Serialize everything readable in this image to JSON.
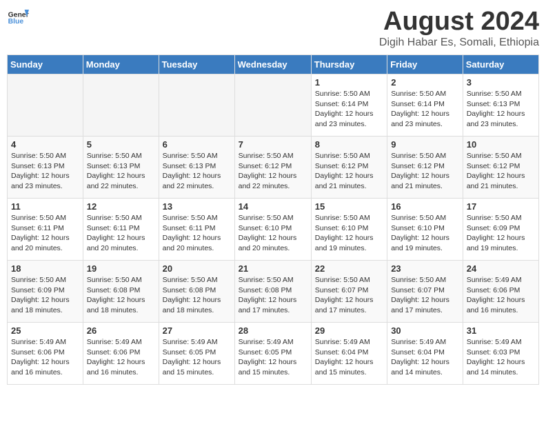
{
  "logo": {
    "text_general": "General",
    "text_blue": "Blue"
  },
  "title": "August 2024",
  "location": "Digih Habar Es, Somali, Ethiopia",
  "weekdays": [
    "Sunday",
    "Monday",
    "Tuesday",
    "Wednesday",
    "Thursday",
    "Friday",
    "Saturday"
  ],
  "weeks": [
    [
      {
        "day": "",
        "info": ""
      },
      {
        "day": "",
        "info": ""
      },
      {
        "day": "",
        "info": ""
      },
      {
        "day": "",
        "info": ""
      },
      {
        "day": "1",
        "info": "Sunrise: 5:50 AM\nSunset: 6:14 PM\nDaylight: 12 hours\nand 23 minutes."
      },
      {
        "day": "2",
        "info": "Sunrise: 5:50 AM\nSunset: 6:14 PM\nDaylight: 12 hours\nand 23 minutes."
      },
      {
        "day": "3",
        "info": "Sunrise: 5:50 AM\nSunset: 6:13 PM\nDaylight: 12 hours\nand 23 minutes."
      }
    ],
    [
      {
        "day": "4",
        "info": "Sunrise: 5:50 AM\nSunset: 6:13 PM\nDaylight: 12 hours\nand 23 minutes."
      },
      {
        "day": "5",
        "info": "Sunrise: 5:50 AM\nSunset: 6:13 PM\nDaylight: 12 hours\nand 22 minutes."
      },
      {
        "day": "6",
        "info": "Sunrise: 5:50 AM\nSunset: 6:13 PM\nDaylight: 12 hours\nand 22 minutes."
      },
      {
        "day": "7",
        "info": "Sunrise: 5:50 AM\nSunset: 6:12 PM\nDaylight: 12 hours\nand 22 minutes."
      },
      {
        "day": "8",
        "info": "Sunrise: 5:50 AM\nSunset: 6:12 PM\nDaylight: 12 hours\nand 21 minutes."
      },
      {
        "day": "9",
        "info": "Sunrise: 5:50 AM\nSunset: 6:12 PM\nDaylight: 12 hours\nand 21 minutes."
      },
      {
        "day": "10",
        "info": "Sunrise: 5:50 AM\nSunset: 6:12 PM\nDaylight: 12 hours\nand 21 minutes."
      }
    ],
    [
      {
        "day": "11",
        "info": "Sunrise: 5:50 AM\nSunset: 6:11 PM\nDaylight: 12 hours\nand 20 minutes."
      },
      {
        "day": "12",
        "info": "Sunrise: 5:50 AM\nSunset: 6:11 PM\nDaylight: 12 hours\nand 20 minutes."
      },
      {
        "day": "13",
        "info": "Sunrise: 5:50 AM\nSunset: 6:11 PM\nDaylight: 12 hours\nand 20 minutes."
      },
      {
        "day": "14",
        "info": "Sunrise: 5:50 AM\nSunset: 6:10 PM\nDaylight: 12 hours\nand 20 minutes."
      },
      {
        "day": "15",
        "info": "Sunrise: 5:50 AM\nSunset: 6:10 PM\nDaylight: 12 hours\nand 19 minutes."
      },
      {
        "day": "16",
        "info": "Sunrise: 5:50 AM\nSunset: 6:10 PM\nDaylight: 12 hours\nand 19 minutes."
      },
      {
        "day": "17",
        "info": "Sunrise: 5:50 AM\nSunset: 6:09 PM\nDaylight: 12 hours\nand 19 minutes."
      }
    ],
    [
      {
        "day": "18",
        "info": "Sunrise: 5:50 AM\nSunset: 6:09 PM\nDaylight: 12 hours\nand 18 minutes."
      },
      {
        "day": "19",
        "info": "Sunrise: 5:50 AM\nSunset: 6:08 PM\nDaylight: 12 hours\nand 18 minutes."
      },
      {
        "day": "20",
        "info": "Sunrise: 5:50 AM\nSunset: 6:08 PM\nDaylight: 12 hours\nand 18 minutes."
      },
      {
        "day": "21",
        "info": "Sunrise: 5:50 AM\nSunset: 6:08 PM\nDaylight: 12 hours\nand 17 minutes."
      },
      {
        "day": "22",
        "info": "Sunrise: 5:50 AM\nSunset: 6:07 PM\nDaylight: 12 hours\nand 17 minutes."
      },
      {
        "day": "23",
        "info": "Sunrise: 5:50 AM\nSunset: 6:07 PM\nDaylight: 12 hours\nand 17 minutes."
      },
      {
        "day": "24",
        "info": "Sunrise: 5:49 AM\nSunset: 6:06 PM\nDaylight: 12 hours\nand 16 minutes."
      }
    ],
    [
      {
        "day": "25",
        "info": "Sunrise: 5:49 AM\nSunset: 6:06 PM\nDaylight: 12 hours\nand 16 minutes."
      },
      {
        "day": "26",
        "info": "Sunrise: 5:49 AM\nSunset: 6:06 PM\nDaylight: 12 hours\nand 16 minutes."
      },
      {
        "day": "27",
        "info": "Sunrise: 5:49 AM\nSunset: 6:05 PM\nDaylight: 12 hours\nand 15 minutes."
      },
      {
        "day": "28",
        "info": "Sunrise: 5:49 AM\nSunset: 6:05 PM\nDaylight: 12 hours\nand 15 minutes."
      },
      {
        "day": "29",
        "info": "Sunrise: 5:49 AM\nSunset: 6:04 PM\nDaylight: 12 hours\nand 15 minutes."
      },
      {
        "day": "30",
        "info": "Sunrise: 5:49 AM\nSunset: 6:04 PM\nDaylight: 12 hours\nand 14 minutes."
      },
      {
        "day": "31",
        "info": "Sunrise: 5:49 AM\nSunset: 6:03 PM\nDaylight: 12 hours\nand 14 minutes."
      }
    ]
  ]
}
